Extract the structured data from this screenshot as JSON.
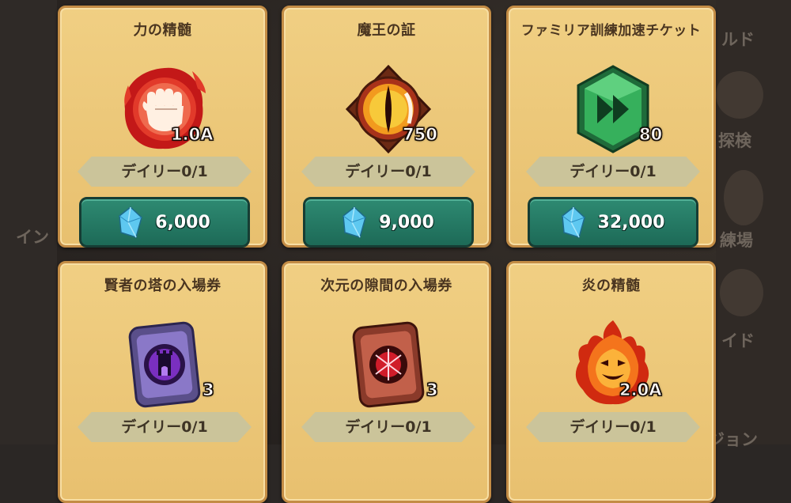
{
  "background": {
    "labels": [
      "ルド",
      "探検",
      "イン",
      "練場",
      "イド",
      "ジョン"
    ]
  },
  "cards": [
    {
      "title": "力の精髄",
      "icon": "red-fist-essence-icon",
      "quantity": "1.0A",
      "daily": "デイリー0/1",
      "price": "6,000"
    },
    {
      "title": "魔王の証",
      "icon": "demon-king-eye-emblem-icon",
      "quantity": "750",
      "daily": "デイリー0/1",
      "price": "9,000"
    },
    {
      "title": "ファミリア訓練加速チケット",
      "icon": "green-fast-forward-ticket-icon",
      "quantity": "80",
      "daily": "デイリー0/1",
      "price": "32,000"
    },
    {
      "title": "賢者の塔の入場券",
      "icon": "purple-tower-ticket-icon",
      "quantity": "3",
      "daily": "デイリー0/1"
    },
    {
      "title": "次元の隙間の入場券",
      "icon": "red-rift-ticket-icon",
      "quantity": "3",
      "daily": "デイリー0/1"
    },
    {
      "title": "炎の精髄",
      "icon": "fire-spirit-essence-icon",
      "quantity": "2.0A",
      "daily": "デイリー0/1"
    }
  ],
  "colors": {
    "card": "#f0cf83",
    "button": "#2e8a72",
    "currency_gem": "#5ec8f0"
  }
}
